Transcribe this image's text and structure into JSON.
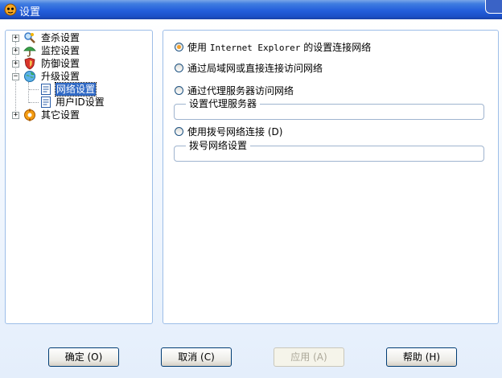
{
  "window": {
    "title": "设置"
  },
  "tree": {
    "items": [
      {
        "label": "查杀设置",
        "icon": "scan-icon",
        "expander": "+"
      },
      {
        "label": "监控设置",
        "icon": "umbrella-icon",
        "expander": "+"
      },
      {
        "label": "防御设置",
        "icon": "shield-icon",
        "expander": "+"
      },
      {
        "label": "升级设置",
        "icon": "update-globe-icon",
        "expander": "−",
        "children": [
          {
            "label": "网络设置",
            "icon": "page-icon",
            "selected": true
          },
          {
            "label": "用户ID设置",
            "icon": "page-icon"
          }
        ]
      },
      {
        "label": "其它设置",
        "icon": "other-settings-icon",
        "expander": "+"
      }
    ]
  },
  "network": {
    "option_ie": {
      "prefix": "使用 ",
      "mono": "Internet Explorer",
      "suffix": " 的设置连接网络",
      "checked": true
    },
    "option_direct": {
      "label": "通过局域网或直接连接访问网络"
    },
    "option_proxy": {
      "label": "通过代理服务器访问网络"
    },
    "proxy_group": {
      "caption": "设置代理服务器"
    },
    "option_dialup": {
      "label": "使用拨号网络连接 (D)"
    },
    "dialup_group": {
      "caption": "拨号网络设置"
    }
  },
  "buttons": {
    "ok": "确定 (O)",
    "cancel": "取消 (C)",
    "apply": "应用 (A)",
    "help": "帮助 (H)"
  },
  "colors": {
    "title_bar": "#245EDB",
    "selection": "#316AC5",
    "panel_border": "#9DBEE8",
    "radio_checked": "#F3A12B"
  }
}
